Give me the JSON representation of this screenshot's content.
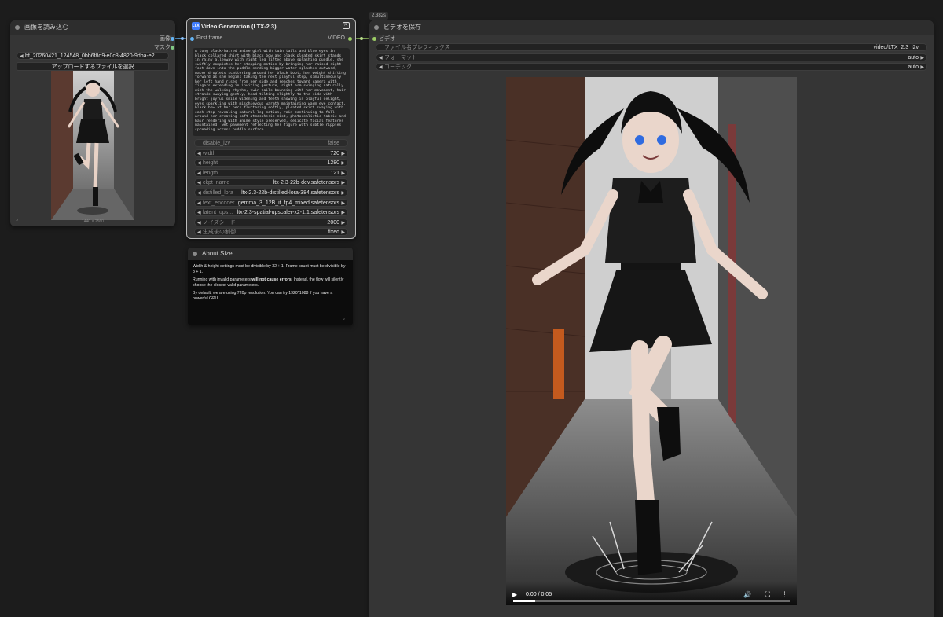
{
  "load_image": {
    "title": "画像を読み込む",
    "outputs": [
      "画像",
      "マスク"
    ],
    "filename": "hf_20260421_124548_0bb6f8d9-e0c8-4820-9dba-e2...",
    "upload_button": "アップロードするファイルを選択",
    "image_size": "1440 × 2560"
  },
  "video_gen": {
    "icon_text": "LTX",
    "title": "Video Generation (LTX-2.3)",
    "input_label": "First frame",
    "output_label": "VIDEO",
    "prompt": "A long black-haired anime girl with twin tails and blue eyes in black collared shirt with black bow and black pleated skirt stands in rainy alleyway with right leg lifted above splashing puddle, she swiftly completes her stepping motion by bringing her raised right foot down into the puddle sending bigger water splashes outward, water droplets scattering around her black boot, her weight shifting forward as she begins taking the next playful step, simultaneously her left hand rises from her side and reaches toward camera with fingers extending in inviting gesture, right arm swinging naturally with the walking rhythm, twin tails bouncing with her movement, hair strands swaying gently, head tilting slightly to the side with bright joyful smile widening and teeth showing in playful delight, eyes sparkling with mischievous warmth maintaining warm eye contact, black bow at her neck fluttering softly, pleated skirt swaying with each step revealing natural leg motion, rain continuing to fall around her creating soft atmospheric mist, photorealistic fabric and hair rendering with anime style preserved, delicate facial features maintained, wet pavement reflecting her figure with subtle ripples spreading across puddle surface",
    "widgets": [
      {
        "label": "disable_i2v",
        "value": "false",
        "toggle": true
      },
      {
        "label": "width",
        "value": "720"
      },
      {
        "label": "height",
        "value": "1280"
      },
      {
        "label": "length",
        "value": "121"
      },
      {
        "label": "ckpt_name",
        "value": "ltx-2.3-22b-dev.safetensors"
      },
      {
        "label": "distilled_lora",
        "value": "ltx-2.3-22b-distilled-lora-384.safetensors"
      },
      {
        "label": "text_encoder",
        "value": "gemma_3_12B_it_fp4_mixed.safetensors"
      },
      {
        "label": "latent_ups...",
        "value": "ltx-2.3-spatial-upscaler-x2-1.1.safetensors"
      },
      {
        "label": "ノイズシード",
        "value": "2000"
      },
      {
        "label": "生成後の制御",
        "value": "fixed"
      }
    ]
  },
  "about": {
    "title": "About Size",
    "p1_a": "Width & height settings must be divisible by 32 + 1. Frame count must be divisible by 8 + 1.",
    "p2_a": "Running with invalid parameters ",
    "p2_b": "will not cause errors",
    "p2_c": ". Instead, the flow will silently choose the closest valid parameters.",
    "p3": "By default, we are using 720p resolution. You can try 1920*1088 if you have a powerful GPU."
  },
  "save_video": {
    "timing": "2.382s",
    "title": "ビデオを保存",
    "input_label": "ビデオ",
    "widgets": [
      {
        "label": "ファイル名プレフィックス",
        "value": "video/LTX_2.3_i2v"
      },
      {
        "label": "フォーマット",
        "value": "auto"
      },
      {
        "label": "コーデック",
        "value": "auto"
      }
    ],
    "player_time": "0:00 / 0:05",
    "progress": 0.08
  },
  "colors": {
    "link_image": "#64b5f6",
    "link_video": "#9ccc65",
    "dot_mask": "#81c784"
  }
}
